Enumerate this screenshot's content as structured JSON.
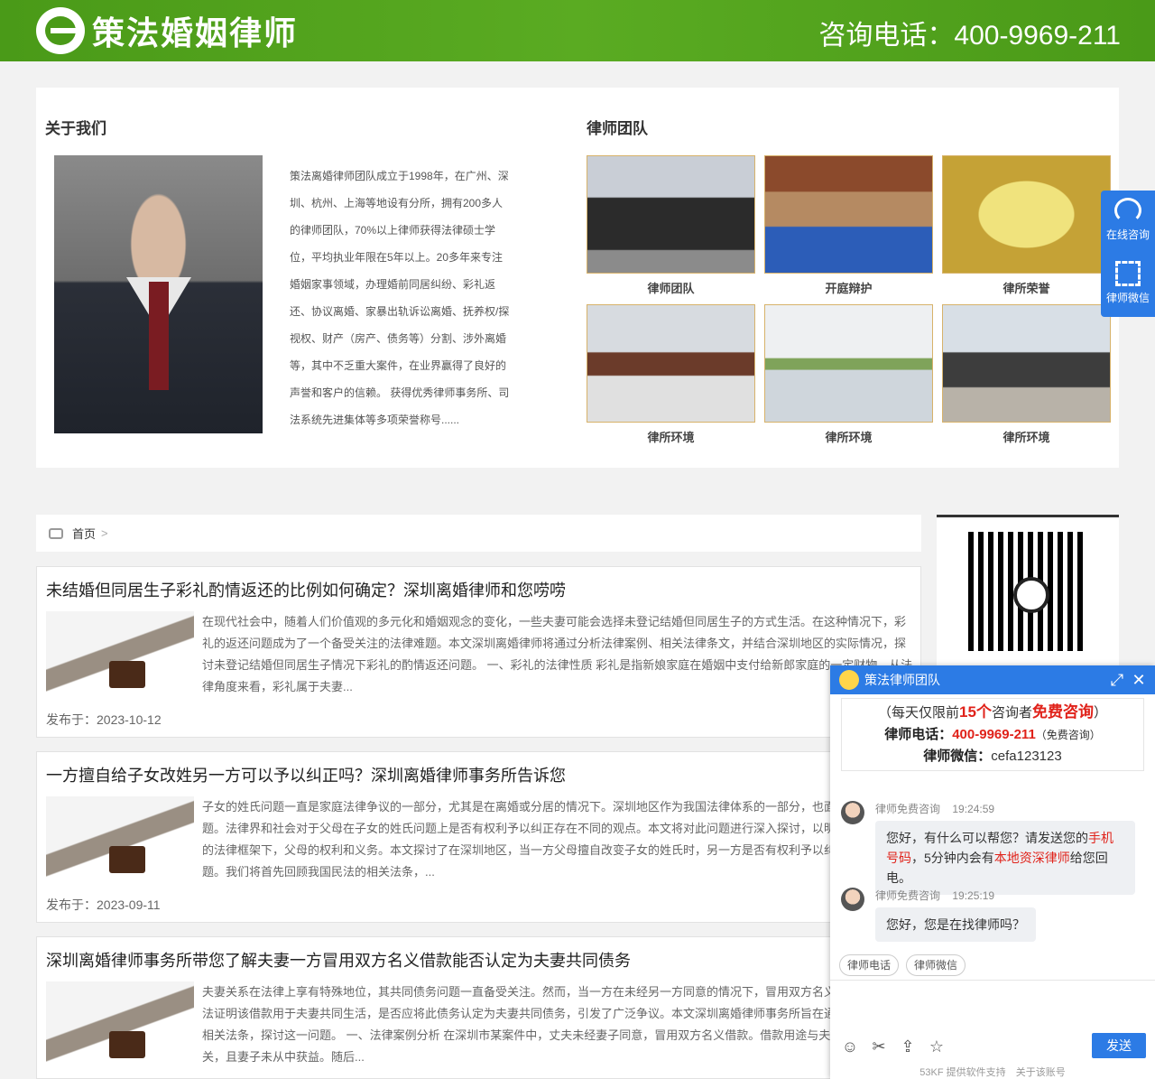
{
  "header": {
    "brand": "策法婚姻律师",
    "hotline": "咨询电话：400-9969-211"
  },
  "about": {
    "title": "关于我们",
    "text": "策法离婚律师团队成立于1998年，在广州、深圳、杭州、上海等地设有分所，拥有200多人的律师团队，70%以上律师获得法律硕士学位，平均执业年限在5年以上。20多年来专注婚姻家事领域，办理婚前同居纠纷、彩礼返还、协议离婚、家暴出轨诉讼离婚、抚养权/探视权、财产（房产、债务等）分割、涉外离婚等，其中不乏重大案件，在业界赢得了良好的声誉和客户的信赖。 获得优秀律师事务所、司法系统先进集体等多项荣誉称号......"
  },
  "team": {
    "title": "律师团队",
    "items": [
      {
        "caption": "律师团队"
      },
      {
        "caption": "开庭辩护"
      },
      {
        "caption": "律所荣誉"
      },
      {
        "caption": "律所环境"
      },
      {
        "caption": "律所环境"
      },
      {
        "caption": "律所环境"
      }
    ]
  },
  "side_tab": {
    "online": "在线咨询",
    "wechat": "律师微信"
  },
  "breadcrumb": {
    "home": "首页",
    "sep": ">"
  },
  "articles": [
    {
      "title": "未结婚但同居生子彩礼酌情返还的比例如何确定？深圳离婚律师和您唠唠",
      "summary": "在现代社会中，随着人们价值观的多元化和婚姻观念的变化，一些夫妻可能会选择未登记结婚但同居生子的方式生活。在这种情况下，彩礼的返还问题成为了一个备受关注的法律难题。本文深圳离婚律师将通过分析法律案例、相关法律条文，并结合深圳地区的实际情况，探讨未登记结婚但同居生子情况下彩礼的酌情返还问题。 一、彩礼的法律性质 彩礼是指新娘家庭在婚姻中支付给新郎家庭的一定财物。从法律角度来看，彩礼属于夫妻...",
      "date": "发布于：2023-10-12"
    },
    {
      "title": "一方擅自给子女改姓另一方可以予以纠正吗？深圳离婚律师事务所告诉您",
      "summary": "子女的姓氏问题一直是家庭法律争议的一部分，尤其是在离婚或分居的情况下。深圳地区作为我国法律体系的一部分，也面临着这一问题。法律界和社会对于父母在子女的姓氏问题上是否有权利予以纠正存在不同的观点。本文将对此问题进行深入探讨，以明确在深圳地区的法律框架下，父母的权利和义务。本文探讨了在深圳地区，当一方父母擅自改变子女的姓氏时，另一方是否有权利予以纠正的法律问题。我们将首先回顾我国民法的相关法条，...",
      "date": "发布于：2023-09-11"
    },
    {
      "title": "深圳离婚律师事务所带您了解夫妻一方冒用双方名义借款能否认定为夫妻共同债务",
      "summary": "夫妻关系在法律上享有特殊地位，其共同债务问题一直备受关注。然而，当一方在未经另一方同意的情况下，冒用双方名义借款，并且无法证明该借款用于夫妻共同生活，是否应将此债务认定为夫妻共同债务，引发了广泛争议。本文深圳离婚律师事务所旨在通过法律案例和相关法条，探讨这一问题。 一、法律案例分析 在深圳市某案件中，丈夫未经妻子同意，冒用双方名义借款。借款用途与夫妻共同生活无关，且妻子未从中获益。随后..."
    }
  ],
  "chat": {
    "title": "策法律师团队",
    "notice_pre": "（每天仅限前",
    "notice_num": "15个",
    "notice_mid": "咨询者",
    "notice_free": "免费咨询",
    "notice_post": "）",
    "phone_label": "律师电话：",
    "phone": "400-9969-211",
    "phone_note": "（免费咨询）",
    "wechat_label": "律师微信：",
    "wechat": "cefa123123",
    "messages": [
      {
        "sender": "律师免费咨询",
        "time": "19:24:59",
        "text_a": "您好，有什么可以帮您？请发送您的",
        "text_b": "手机号码",
        "text_c": "，5分钟内会有",
        "text_d": "本地资深律师",
        "text_e": "给您回电。"
      },
      {
        "sender": "律师免费咨询",
        "time": "19:25:19",
        "text": "您好，您是在找律师吗？"
      }
    ],
    "quick_phone": "律师电话",
    "quick_wechat": "律师微信",
    "send": "发送",
    "powered": "53KF 提供软件支持",
    "about_account": "关于该账号"
  }
}
